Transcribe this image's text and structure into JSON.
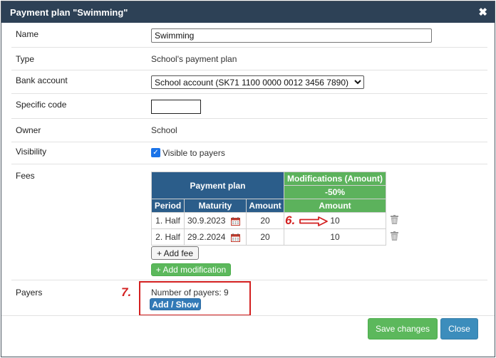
{
  "dialog": {
    "title": "Payment plan \"Swimming\"",
    "close_icon": "✖"
  },
  "form": {
    "name_label": "Name",
    "name_value": "Swimming",
    "type_label": "Type",
    "type_value": "School's payment plan",
    "bank_label": "Bank account",
    "bank_value": "School account (SK71 1100 0000 0012 3456 7890)",
    "specific_label": "Specific code",
    "specific_value": "",
    "owner_label": "Owner",
    "owner_value": "School",
    "visibility_label": "Visibility",
    "visibility_value": "Visible to payers",
    "fees_label": "Fees",
    "payers_label": "Payers"
  },
  "fees_table": {
    "plan_header": "Payment plan",
    "mod_header": "Modifications (Amount)",
    "mod_sub": "-50%",
    "col_period": "Period",
    "col_maturity": "Maturity",
    "col_amount": "Amount",
    "col_mod_amount": "Amount",
    "rows": [
      {
        "period": "1. Half",
        "maturity": "30.9.2023",
        "amount": "20",
        "mod": "10"
      },
      {
        "period": "2. Half",
        "maturity": "29.2.2024",
        "amount": "20",
        "mod": "10"
      }
    ]
  },
  "buttons": {
    "add_fee": "+ Add fee",
    "add_modification": "+ Add modification",
    "add_show": "Add / Show",
    "save": "Save changes",
    "close": "Close"
  },
  "payers": {
    "count_text": "Number of payers: 9"
  },
  "annotations": {
    "six": "6.",
    "seven": "7."
  },
  "colors": {
    "titlebar": "#2d4156",
    "table_blue": "#2b5d8a",
    "table_green": "#5cb25c",
    "annotation_red": "#d32020"
  }
}
